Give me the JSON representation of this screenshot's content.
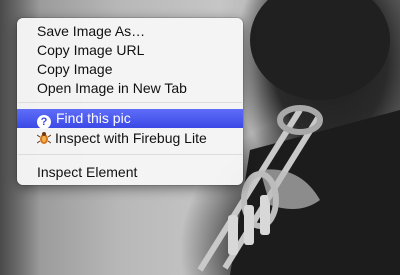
{
  "context_menu": {
    "items": [
      {
        "label": "Save Image As…"
      },
      {
        "label": "Copy Image URL"
      },
      {
        "label": "Copy Image"
      },
      {
        "label": "Open Image in New Tab"
      },
      {
        "label": "Find this pic",
        "icon": "question-mark-icon",
        "highlighted": true
      },
      {
        "label": "Inspect with Firebug Lite",
        "icon": "firebug-icon"
      },
      {
        "label": "Inspect Element"
      }
    ]
  },
  "colors": {
    "highlight": "#3b4ae6",
    "menu_bg": "#f6f6f6"
  }
}
